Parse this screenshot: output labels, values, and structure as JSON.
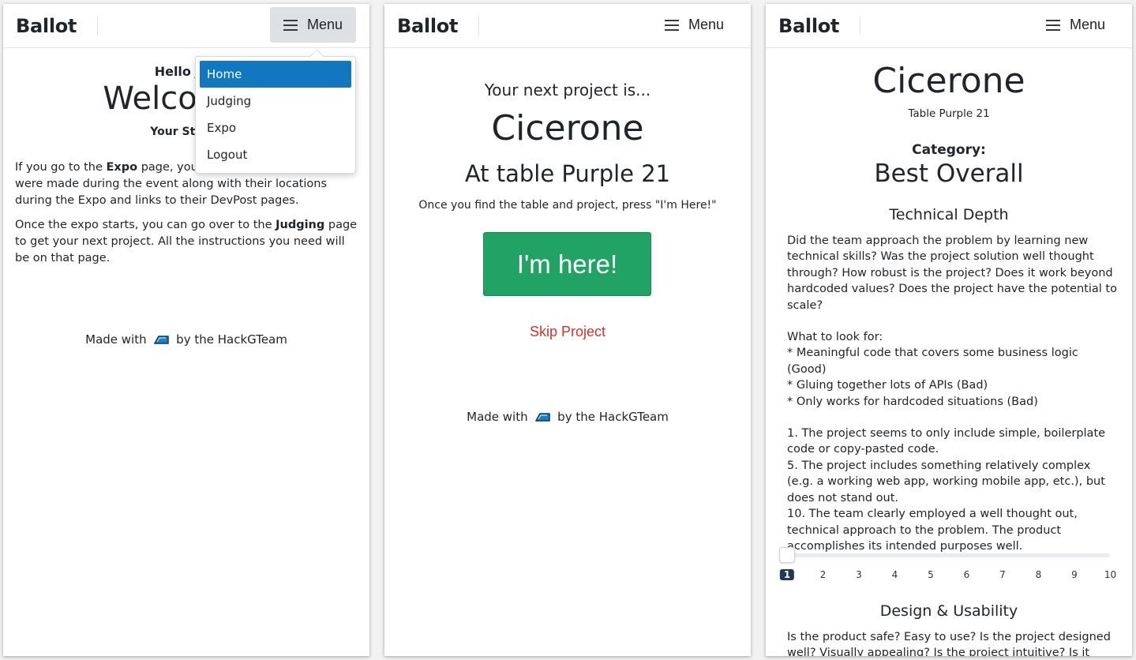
{
  "brand": "Ballot",
  "menu_label": "Menu",
  "dropdown_items": [
    "Home",
    "Judging",
    "Expo",
    "Logout"
  ],
  "home": {
    "hello": "Hello Jud",
    "welcome": "Welcome t",
    "status": "Your Status",
    "p1_prefix": "If you go to the ",
    "p1_bold": "Expo",
    "p1_mid": " page, you c",
    "p1_rest": "were made during the event along with their locations during the Expo and links to their DevPost pages.",
    "p2_prefix": "Once the expo starts, you can go over to the ",
    "p2_bold": "Judging",
    "p2_rest": " page to get your next project. All the instructions you need will be on that page."
  },
  "footer": {
    "made_with": "Made with",
    "by": "by the HackGTeam"
  },
  "judging": {
    "next_label": "Your next project is...",
    "project_name": "Cicerone",
    "table_text": "At table Purple 21",
    "hint": "Once you find the table and project, press \"I'm Here!\"",
    "here_button": "I'm here!",
    "skip": "Skip Project"
  },
  "scoring": {
    "project_name": "Cicerone",
    "table": "Table Purple 21",
    "category_label": "Category:",
    "category": "Best Overall",
    "criterion1": {
      "title": "Technical Depth",
      "question": "Did the team approach the problem by learning new technical skills? Was the project solution well thought through? How robust is the project? Does it work beyond hardcoded values? Does the project have the potential to scale?",
      "look_for": "What to look for:",
      "bullets": [
        "* Meaningful code that covers some business logic (Good)",
        "* Gluing together lots of APIs (Bad)",
        "* Only works for hardcoded situations (Bad)"
      ],
      "levels": [
        "1. The project seems to only include simple, boilerplate code or copy-pasted code.",
        "5. The project includes something relatively complex (e.g. a working web app, working mobile app, etc.), but does not stand out.",
        "10. The team clearly employed a well thought out, technical approach to the problem. The product accomplishes its intended purposes well."
      ],
      "scale": [
        "1",
        "2",
        "3",
        "4",
        "5",
        "6",
        "7",
        "8",
        "9",
        "10"
      ],
      "selected": 1
    },
    "criterion2": {
      "title": "Design & Usability",
      "question": "Is the product safe? Easy to use? Is the project designed well? Visually appealing? Is the project intuitive? Is it easy"
    }
  },
  "colors": {
    "accent": "#1178bf",
    "success": "#21a366",
    "danger": "#d0322b",
    "slider_selected": "#1f3a56"
  }
}
